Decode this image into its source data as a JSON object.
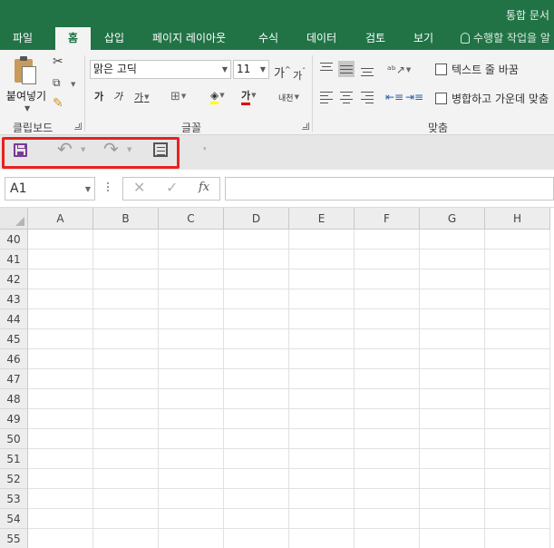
{
  "window": {
    "title": "통합 문서"
  },
  "tabs": [
    {
      "id": "file",
      "label": "파일"
    },
    {
      "id": "home",
      "label": "홈"
    },
    {
      "id": "insert",
      "label": "삽입"
    },
    {
      "id": "page_layout",
      "label": "페이지 레이아웃"
    },
    {
      "id": "formulas",
      "label": "수식"
    },
    {
      "id": "data",
      "label": "데이터"
    },
    {
      "id": "review",
      "label": "검토"
    },
    {
      "id": "view",
      "label": "보기"
    }
  ],
  "tell_me": "수행할 작업을 알",
  "ribbon": {
    "clipboard": {
      "paste_label": "붙여넣기",
      "group_label": "클립보드"
    },
    "font": {
      "font_name": "맑은 고딕",
      "font_size": "11",
      "grow": "가",
      "shrink": "가",
      "bold": "가",
      "italic": "가",
      "underline": "가",
      "font_color_glyph": "가",
      "phonetic": "내천",
      "group_label": "글꼴"
    },
    "alignment": {
      "wrap_text": "텍스트 줄 바꿈",
      "merge_center": "병합하고 가운데 맞춤",
      "group_label": "맞춤"
    }
  },
  "quick_access": {
    "save": "save",
    "undo": "undo",
    "redo": "redo",
    "form": "form"
  },
  "formula_bar": {
    "name_box": "A1",
    "cancel_glyph": "✕",
    "enter_glyph": "✓",
    "fx_label": "fx",
    "formula": ""
  },
  "grid": {
    "columns": [
      "A",
      "B",
      "C",
      "D",
      "E",
      "F",
      "G",
      "H"
    ],
    "rows": [
      "40",
      "41",
      "42",
      "43",
      "44",
      "45",
      "46",
      "47",
      "48",
      "49",
      "50",
      "51",
      "52",
      "53",
      "54",
      "55"
    ]
  },
  "colors": {
    "accent": "#217346",
    "highlight_box": "#e8211f",
    "save_icon": "#7a3b99"
  }
}
